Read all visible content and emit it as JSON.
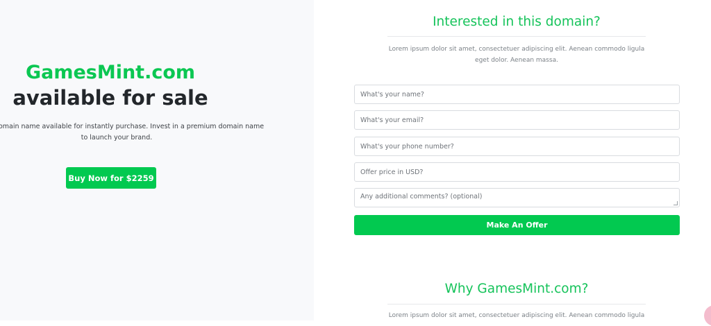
{
  "left": {
    "brand": "GamesMint.com",
    "headline": "available for sale",
    "lead_line1": "emium domain name available for instantly purchase. Invest in a premium domain name",
    "lead_line2": "to launch your brand.",
    "buy_button_label": "Buy Now for $2259"
  },
  "offer_section": {
    "title": "Interested in this domain?",
    "text_line1": "Lorem ipsum dolor sit amet, consectetuer adipiscing elit. Aenean commodo ligula",
    "text_line2": "eget dolor. Aenean massa.",
    "fields": {
      "name_placeholder": "What's your name?",
      "email_placeholder": "What's your email?",
      "phone_placeholder": "What's your phone number?",
      "price_placeholder": "Offer price in USD?",
      "comments_placeholder": "Any additional comments? (optional)"
    },
    "submit_label": "Make An Offer"
  },
  "why_section": {
    "title": "Why GamesMint.com?",
    "text_line1": "Lorem ipsum dolor sit amet, consectetuer adipiscing elit. Aenean commodo ligula"
  },
  "colors": {
    "accent": "#02c950",
    "left_background": "#f8f9fb",
    "headline": "#23272b"
  }
}
